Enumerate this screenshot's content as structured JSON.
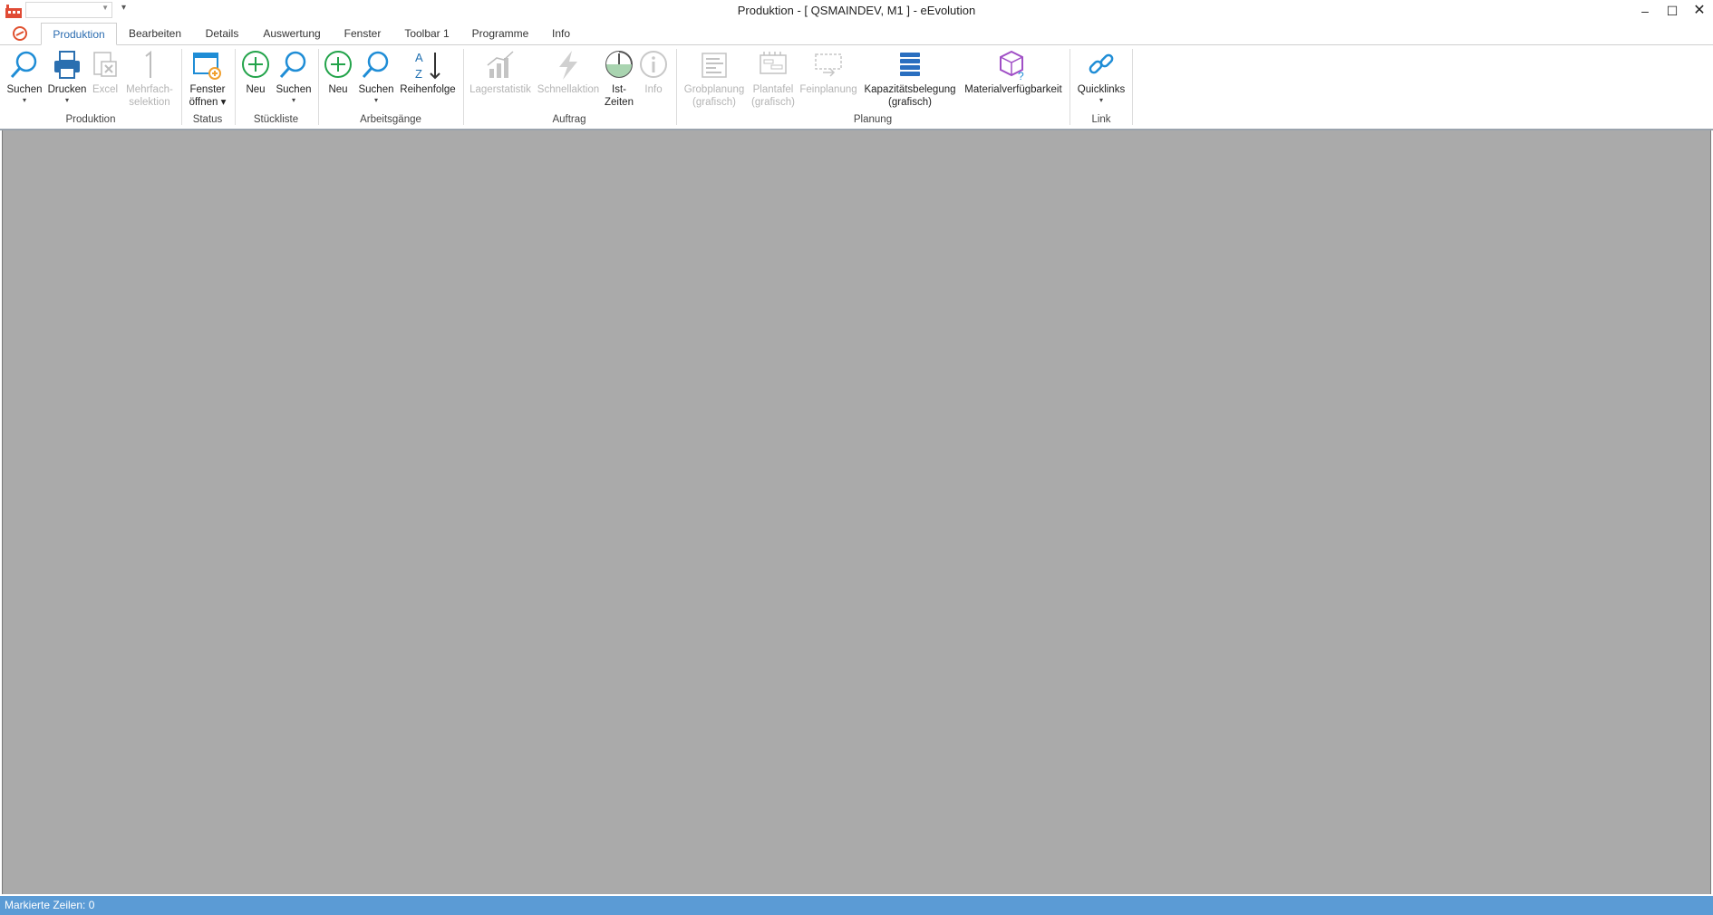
{
  "window": {
    "title": "Produktion - [ QSMAINDEV, M1 ]  -  eEvolution",
    "controls": {
      "minimize": "–",
      "maximize": "☐",
      "close": "✕"
    }
  },
  "quick_access": {
    "combo_value": "",
    "customize_glyph": "▾"
  },
  "tabs": [
    {
      "label": "Produktion",
      "active": true
    },
    {
      "label": "Bearbeiten"
    },
    {
      "label": "Details"
    },
    {
      "label": "Auswertung"
    },
    {
      "label": "Fenster"
    },
    {
      "label": "Toolbar 1"
    },
    {
      "label": "Programme"
    },
    {
      "label": "Info"
    }
  ],
  "ribbon": {
    "groups": {
      "produktion": {
        "label": "Produktion",
        "suchen": {
          "label": "Suchen",
          "dropdown": "▾"
        },
        "drucken": {
          "label": "Drucken",
          "dropdown": "▾"
        },
        "excel": {
          "label": "Excel",
          "disabled": true
        },
        "mehrfach": {
          "line1": "Mehrfach-",
          "line2": "selektion",
          "disabled": true
        }
      },
      "status": {
        "label": "Status",
        "fenster": {
          "line1": "Fenster",
          "line2": "öffnen ▾"
        }
      },
      "stueckliste": {
        "label": "Stückliste",
        "neu": {
          "label": "Neu"
        },
        "suchen": {
          "label": "Suchen",
          "dropdown": "▾"
        }
      },
      "arbeitsgaenge": {
        "label": "Arbeitsgänge",
        "neu": {
          "label": "Neu"
        },
        "suchen": {
          "label": "Suchen",
          "dropdown": "▾"
        },
        "reihenfolge": {
          "label": "Reihenfolge"
        }
      },
      "auftrag": {
        "label": "Auftrag",
        "lagerstatistik": {
          "label": "Lagerstatistik",
          "disabled": true
        },
        "schnellaktion": {
          "label": "Schnellaktion",
          "disabled": true
        },
        "istzeiten": {
          "line1": "Ist-",
          "line2": "Zeiten"
        },
        "info": {
          "label": "Info",
          "disabled": true
        }
      },
      "planung": {
        "label": "Planung",
        "grobplanung": {
          "line1": "Grobplanung",
          "line2": "(grafisch)",
          "disabled": true
        },
        "plantafel": {
          "line1": "Plantafel",
          "line2": "(grafisch)",
          "disabled": true
        },
        "feinplanung": {
          "label": "Feinplanung",
          "disabled": true
        },
        "kapazitaet": {
          "line1": "Kapazitätsbelegung",
          "line2": "(grafisch)"
        },
        "material": {
          "label": "Materialverfügbarkeit"
        }
      },
      "link": {
        "label": "Link",
        "quicklinks": {
          "label": "Quicklinks",
          "dropdown": "▾"
        }
      }
    }
  },
  "statusbar": {
    "text": "Markierte Zeilen: 0"
  },
  "colors": {
    "accent": "#2b6cb0",
    "workspace": "#aaaaaa",
    "statusbar": "#5b9bd5",
    "disabled_text": "#b4b4b4",
    "icon_blue": "#1f8dd6",
    "icon_green": "#22a34a",
    "icon_purple": "#a04fc6"
  },
  "icons": {
    "app": "factory-icon",
    "app_menu": "app-menu-icon",
    "suchen": "magnifier-icon",
    "drucken": "printer-icon",
    "excel": "excel-icon",
    "mehrfach": "number-one-icon",
    "fenster": "window-add-icon",
    "neu": "plus-circle-icon",
    "reihenfolge": "sort-az-icon",
    "lagerstatistik": "bar-chart-icon",
    "schnellaktion": "lightning-icon",
    "istzeiten": "pie-clock-icon",
    "info": "info-icon",
    "grobplanung": "gantt-icon",
    "plantafel": "plan-board-icon",
    "feinplanung": "fine-plan-icon",
    "kapazitaet": "stack-icon",
    "material": "cube-question-icon",
    "quicklinks": "link-icon"
  }
}
